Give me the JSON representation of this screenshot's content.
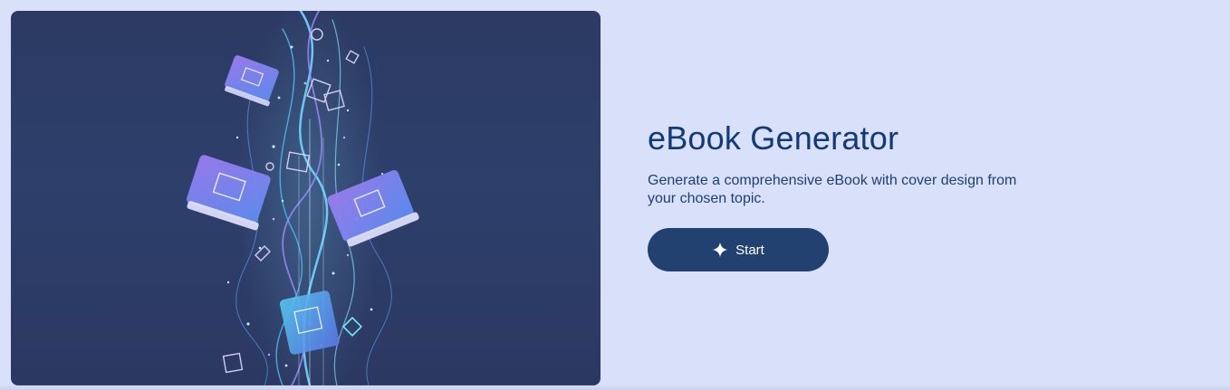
{
  "card": {
    "title": "eBook Generator",
    "description": "Generate a comprehensive eBook with cover design from your chosen topic.",
    "start_label": "Start",
    "image_alt": "Illustration of glowing books in a stream of light",
    "start_icon": "sparkle-icon"
  },
  "colors": {
    "page_background": "#d9e0f9",
    "title": "#123a78",
    "button": "#224171",
    "image_background": "#2c3a63"
  }
}
